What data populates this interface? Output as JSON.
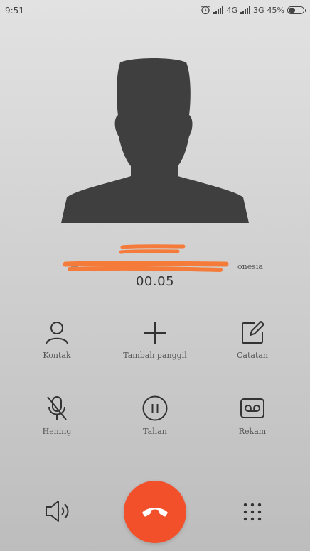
{
  "status_bar": {
    "time": "9:51",
    "network_1": "4G",
    "network_2": "3G",
    "battery_percent": "45%",
    "battery_level": 0.45,
    "icons": [
      "alarm-icon",
      "signal-icon",
      "signal-icon",
      "battery-icon"
    ]
  },
  "caller": {
    "info_suffix": "onesia",
    "duration": "00.05"
  },
  "actions": [
    {
      "label": "Kontak",
      "icon": "contact-icon"
    },
    {
      "label": "Tambah panggil",
      "icon": "plus-icon"
    },
    {
      "label": "Catatan",
      "icon": "note-icon"
    },
    {
      "label": "Hening",
      "icon": "mic-off-icon"
    },
    {
      "label": "Tahan",
      "icon": "pause-icon"
    },
    {
      "label": "Rekam",
      "icon": "record-icon"
    }
  ],
  "bottom": {
    "speaker_icon": "speaker-icon",
    "end_call_icon": "end-call-icon",
    "dialpad_icon": "dialpad-icon"
  },
  "colors": {
    "end_call": "#f2502a",
    "redaction": "#f47b3a",
    "avatar": "#3f3f3f"
  }
}
